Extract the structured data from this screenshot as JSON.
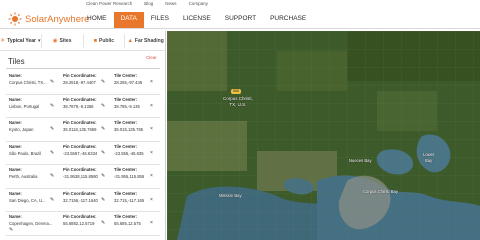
{
  "topbar": {
    "links": [
      "Clean Power Research",
      "Blog",
      "News",
      "Company"
    ]
  },
  "logo": {
    "brand": "SolarAnywhere",
    "icon": "sun-logo-icon"
  },
  "nav": {
    "items": [
      {
        "label": "HOME",
        "active": false
      },
      {
        "label": "DATA",
        "active": true
      },
      {
        "label": "FILES",
        "active": false
      },
      {
        "label": "LICENSE",
        "active": false
      },
      {
        "label": "SUPPORT",
        "active": false
      },
      {
        "label": "PURCHASE",
        "active": false
      }
    ]
  },
  "options": {
    "typical_year": "Typical Year",
    "sites": "Sites",
    "public": "Public",
    "far_shading": "Far Shading"
  },
  "tiles": {
    "title": "Tiles",
    "clear": "Clear",
    "name_header": "Name:",
    "pin_header": "Pin Coordinates:",
    "center_header": "Tile Center:",
    "rows": [
      {
        "name": "Corpus Christi, TX...",
        "pin": "28.2518,-97.4407",
        "center": "28.255,-97.445"
      },
      {
        "name": "Lisbon, Portugal",
        "pin": "38.7879,-9.1356",
        "center": "38.785,-9.135"
      },
      {
        "name": "Kyoto, Japan",
        "pin": "35.0118,135.7669",
        "center": "35.015,135.765"
      },
      {
        "name": "São Paulo, Brazil",
        "pin": "-23.5567,-46.6334",
        "center": "-23.555,-46.635"
      },
      {
        "name": "Perth, Australia",
        "pin": "-31.9538,115.8580",
        "center": "-31.955,115.855"
      },
      {
        "name": "San Diego, CA, U...",
        "pin": "32.7156,-117.1640",
        "center": "32.715,-117.165"
      },
      {
        "name": "Copenhagen, Denma...",
        "pin": "55.6882,12.5719",
        "center": "55.685,12.575"
      }
    ]
  },
  "map": {
    "pin_tag": "888",
    "pin_label_line1": "Corpus Christi,",
    "pin_label_line2": "TX, U.S.",
    "labels": {
      "mission_bay": "Mission Bay",
      "nueces_bay": "Nueces Bay",
      "corpus_christi_bay": "Corpus Christi Bay",
      "lower_bay": "Lower",
      "lower_bay2": "Bay"
    }
  }
}
